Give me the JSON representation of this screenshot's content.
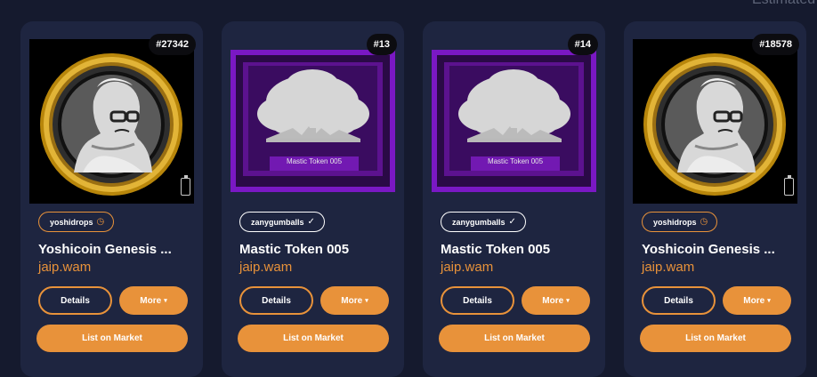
{
  "header": {
    "estimated_label": "Estimated"
  },
  "cards": [
    {
      "id_badge": "#27342",
      "collection": "yoshidrops",
      "collection_verified": "pending",
      "title": "Yoshicoin Genesis ...",
      "owner": "jaip.wam",
      "details_label": "Details",
      "more_label": "More",
      "list_label": "List on Market",
      "image": "yoshicoin"
    },
    {
      "id_badge": "#13",
      "collection": "zanygumballs",
      "collection_verified": "verified",
      "title": "Mastic Token 005",
      "owner": "jaip.wam",
      "details_label": "Details",
      "more_label": "More",
      "list_label": "List on Market",
      "image": "mastic",
      "image_caption": "Mastic Token 005"
    },
    {
      "id_badge": "#14",
      "collection": "zanygumballs",
      "collection_verified": "verified",
      "title": "Mastic Token 005",
      "owner": "jaip.wam",
      "details_label": "Details",
      "more_label": "More",
      "list_label": "List on Market",
      "image": "mastic",
      "image_caption": "Mastic Token 005"
    },
    {
      "id_badge": "#18578",
      "collection": "yoshidrops",
      "collection_verified": "pending",
      "title": "Yoshicoin Genesis ...",
      "owner": "jaip.wam",
      "details_label": "Details",
      "more_label": "More",
      "list_label": "List on Market",
      "image": "yoshicoin"
    }
  ],
  "colors": {
    "accent": "#e8923a",
    "card_bg": "#1e2540",
    "page_bg": "#151a2e",
    "purple": "#8a1fd6"
  },
  "icons": {
    "pending": "clock-check-icon",
    "verified": "checkmark-icon",
    "battery": "battery-icon",
    "more": "caret-down-icon"
  }
}
